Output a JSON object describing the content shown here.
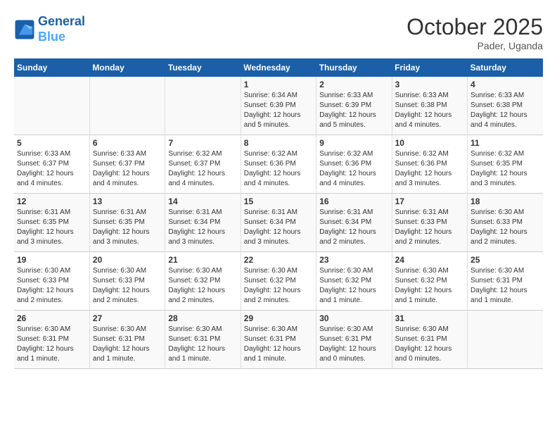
{
  "header": {
    "logo_line1": "General",
    "logo_line2": "Blue",
    "title": "October 2025",
    "location": "Pader, Uganda"
  },
  "days_header": [
    "Sunday",
    "Monday",
    "Tuesday",
    "Wednesday",
    "Thursday",
    "Friday",
    "Saturday"
  ],
  "weeks": [
    [
      {
        "day": "",
        "info": ""
      },
      {
        "day": "",
        "info": ""
      },
      {
        "day": "",
        "info": ""
      },
      {
        "day": "1",
        "info": "Sunrise: 6:34 AM\nSunset: 6:39 PM\nDaylight: 12 hours\nand 5 minutes."
      },
      {
        "day": "2",
        "info": "Sunrise: 6:33 AM\nSunset: 6:39 PM\nDaylight: 12 hours\nand 5 minutes."
      },
      {
        "day": "3",
        "info": "Sunrise: 6:33 AM\nSunset: 6:38 PM\nDaylight: 12 hours\nand 4 minutes."
      },
      {
        "day": "4",
        "info": "Sunrise: 6:33 AM\nSunset: 6:38 PM\nDaylight: 12 hours\nand 4 minutes."
      }
    ],
    [
      {
        "day": "5",
        "info": "Sunrise: 6:33 AM\nSunset: 6:37 PM\nDaylight: 12 hours\nand 4 minutes."
      },
      {
        "day": "6",
        "info": "Sunrise: 6:33 AM\nSunset: 6:37 PM\nDaylight: 12 hours\nand 4 minutes."
      },
      {
        "day": "7",
        "info": "Sunrise: 6:32 AM\nSunset: 6:37 PM\nDaylight: 12 hours\nand 4 minutes."
      },
      {
        "day": "8",
        "info": "Sunrise: 6:32 AM\nSunset: 6:36 PM\nDaylight: 12 hours\nand 4 minutes."
      },
      {
        "day": "9",
        "info": "Sunrise: 6:32 AM\nSunset: 6:36 PM\nDaylight: 12 hours\nand 4 minutes."
      },
      {
        "day": "10",
        "info": "Sunrise: 6:32 AM\nSunset: 6:36 PM\nDaylight: 12 hours\nand 3 minutes."
      },
      {
        "day": "11",
        "info": "Sunrise: 6:32 AM\nSunset: 6:35 PM\nDaylight: 12 hours\nand 3 minutes."
      }
    ],
    [
      {
        "day": "12",
        "info": "Sunrise: 6:31 AM\nSunset: 6:35 PM\nDaylight: 12 hours\nand 3 minutes."
      },
      {
        "day": "13",
        "info": "Sunrise: 6:31 AM\nSunset: 6:35 PM\nDaylight: 12 hours\nand 3 minutes."
      },
      {
        "day": "14",
        "info": "Sunrise: 6:31 AM\nSunset: 6:34 PM\nDaylight: 12 hours\nand 3 minutes."
      },
      {
        "day": "15",
        "info": "Sunrise: 6:31 AM\nSunset: 6:34 PM\nDaylight: 12 hours\nand 3 minutes."
      },
      {
        "day": "16",
        "info": "Sunrise: 6:31 AM\nSunset: 6:34 PM\nDaylight: 12 hours\nand 2 minutes."
      },
      {
        "day": "17",
        "info": "Sunrise: 6:31 AM\nSunset: 6:33 PM\nDaylight: 12 hours\nand 2 minutes."
      },
      {
        "day": "18",
        "info": "Sunrise: 6:30 AM\nSunset: 6:33 PM\nDaylight: 12 hours\nand 2 minutes."
      }
    ],
    [
      {
        "day": "19",
        "info": "Sunrise: 6:30 AM\nSunset: 6:33 PM\nDaylight: 12 hours\nand 2 minutes."
      },
      {
        "day": "20",
        "info": "Sunrise: 6:30 AM\nSunset: 6:33 PM\nDaylight: 12 hours\nand 2 minutes."
      },
      {
        "day": "21",
        "info": "Sunrise: 6:30 AM\nSunset: 6:32 PM\nDaylight: 12 hours\nand 2 minutes."
      },
      {
        "day": "22",
        "info": "Sunrise: 6:30 AM\nSunset: 6:32 PM\nDaylight: 12 hours\nand 2 minutes."
      },
      {
        "day": "23",
        "info": "Sunrise: 6:30 AM\nSunset: 6:32 PM\nDaylight: 12 hours\nand 1 minute."
      },
      {
        "day": "24",
        "info": "Sunrise: 6:30 AM\nSunset: 6:32 PM\nDaylight: 12 hours\nand 1 minute."
      },
      {
        "day": "25",
        "info": "Sunrise: 6:30 AM\nSunset: 6:31 PM\nDaylight: 12 hours\nand 1 minute."
      }
    ],
    [
      {
        "day": "26",
        "info": "Sunrise: 6:30 AM\nSunset: 6:31 PM\nDaylight: 12 hours\nand 1 minute."
      },
      {
        "day": "27",
        "info": "Sunrise: 6:30 AM\nSunset: 6:31 PM\nDaylight: 12 hours\nand 1 minute."
      },
      {
        "day": "28",
        "info": "Sunrise: 6:30 AM\nSunset: 6:31 PM\nDaylight: 12 hours\nand 1 minute."
      },
      {
        "day": "29",
        "info": "Sunrise: 6:30 AM\nSunset: 6:31 PM\nDaylight: 12 hours\nand 1 minute."
      },
      {
        "day": "30",
        "info": "Sunrise: 6:30 AM\nSunset: 6:31 PM\nDaylight: 12 hours\nand 0 minutes."
      },
      {
        "day": "31",
        "info": "Sunrise: 6:30 AM\nSunset: 6:31 PM\nDaylight: 12 hours\nand 0 minutes."
      },
      {
        "day": "",
        "info": ""
      }
    ]
  ]
}
